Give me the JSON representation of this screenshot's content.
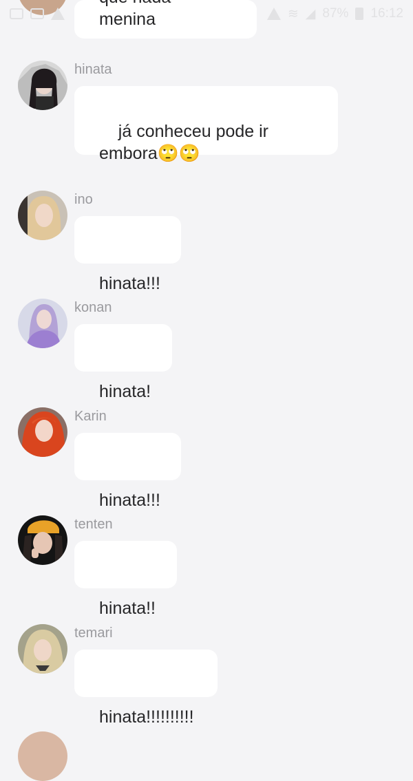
{
  "status_bar": {
    "battery": "87%",
    "time": "16:12",
    "left_icons": [
      "image-icon",
      "photo-icon",
      "warning-icon"
    ],
    "right_icons": [
      "warning-icon",
      "wifi-icon",
      "signal-icon",
      "battery-icon"
    ]
  },
  "messages": [
    {
      "text": "que nada menina"
    },
    {
      "sender": "hinata",
      "text": "já conheceu pode ir\nembora🙄🙄"
    },
    {
      "sender": "ino",
      "text": "hinata!!!"
    },
    {
      "sender": "konan",
      "text": "hinata!"
    },
    {
      "sender": "Karin",
      "text": "hinata!!!"
    },
    {
      "sender": "tenten",
      "text": "hinata!!"
    },
    {
      "sender": "temari",
      "text": "hinata!!!!!!!!!!"
    }
  ],
  "colors": {
    "background": "#f4f4f6",
    "bubble": "#ffffff",
    "sender": "#9a9a9e",
    "text": "#262628"
  }
}
